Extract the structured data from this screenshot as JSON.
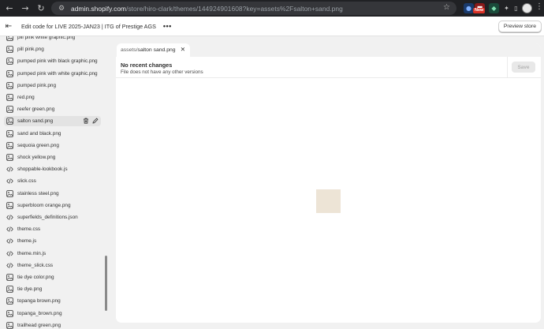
{
  "browser": {
    "url_host": "admin.shopify.com",
    "url_path": "/store/hiro-clark/themes/144924901608?key=assets%2Fsalton+sand.png",
    "ext_badge": "New"
  },
  "header": {
    "title": "Edit code for LIVE 2025-JAN23 | ITG of Prestige AGS",
    "more": "•••",
    "preview_label": "Preview store"
  },
  "sidebar": {
    "files": [
      {
        "name": "pill pink white graphic.png",
        "kind": "image"
      },
      {
        "name": "pill pink.png",
        "kind": "image"
      },
      {
        "name": "pumped pink with black graphic.png",
        "kind": "image"
      },
      {
        "name": "pumped pink with white graphic.png",
        "kind": "image"
      },
      {
        "name": "pumped pink.png",
        "kind": "image"
      },
      {
        "name": "red.png",
        "kind": "image"
      },
      {
        "name": "reefer green.png",
        "kind": "image"
      },
      {
        "name": "salton sand.png",
        "kind": "image",
        "selected": true
      },
      {
        "name": "sand and black.png",
        "kind": "image"
      },
      {
        "name": "sequoia green.png",
        "kind": "image"
      },
      {
        "name": "shock yellow.png",
        "kind": "image"
      },
      {
        "name": "shoppable-lookbook.js",
        "kind": "code"
      },
      {
        "name": "slick.css",
        "kind": "code"
      },
      {
        "name": "stainless steel.png",
        "kind": "image"
      },
      {
        "name": "superbloom orange.png",
        "kind": "image"
      },
      {
        "name": "superfields_definitions.json",
        "kind": "code"
      },
      {
        "name": "theme.css",
        "kind": "code"
      },
      {
        "name": "theme.js",
        "kind": "code"
      },
      {
        "name": "theme.min.js",
        "kind": "code"
      },
      {
        "name": "theme_slick.css",
        "kind": "code"
      },
      {
        "name": "tie dye color.png",
        "kind": "image"
      },
      {
        "name": "tie dye.png",
        "kind": "image"
      },
      {
        "name": "topanga brown.png",
        "kind": "image"
      },
      {
        "name": "topanga_brown.png",
        "kind": "image"
      },
      {
        "name": "trailhead green.png",
        "kind": "image"
      }
    ]
  },
  "editor": {
    "tab_dir": "assets/",
    "tab_file": "salton sand.png",
    "changes_title": "No recent changes",
    "changes_subtitle": "File does not have any other versions",
    "save_label": "Save",
    "preview_color": "#ede4d6"
  }
}
